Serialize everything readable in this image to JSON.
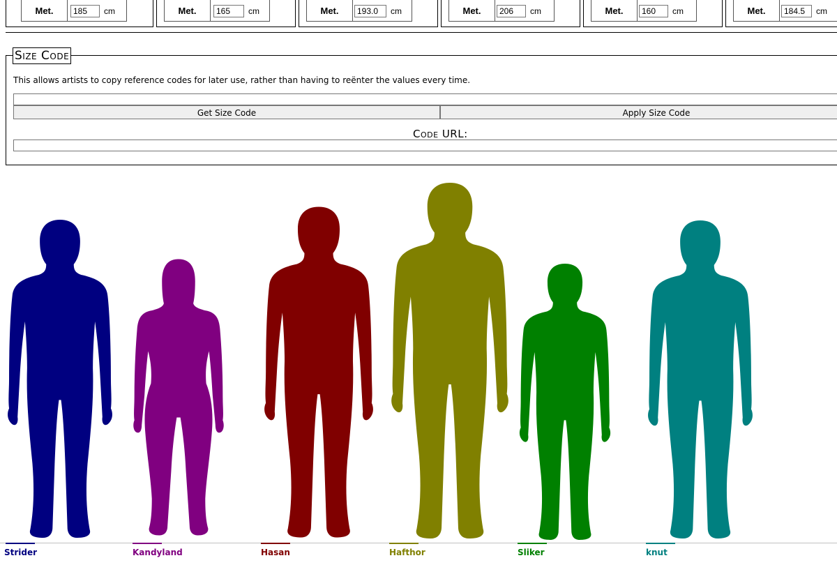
{
  "top_panels": {
    "met_label": "Met.",
    "unit": "cm",
    "values": [
      "185",
      "165",
      "193.0",
      "206",
      "160",
      "184.5"
    ]
  },
  "size_code": {
    "title": "Size Code",
    "description": "This allows artists to copy reference codes for later use, rather than having to reënter the values every time.",
    "code_value": "",
    "get_button": "Get Size Code",
    "apply_button": "Apply Size Code",
    "url_label": "Code URL:",
    "url_value": ""
  },
  "characters": [
    {
      "name": "Strider",
      "height_cm": 185,
      "color": "#000080",
      "gender": "male"
    },
    {
      "name": "Kandyland",
      "height_cm": 165,
      "color": "#800080",
      "gender": "female"
    },
    {
      "name": "Hasan",
      "height_cm": 193.0,
      "color": "#800000",
      "gender": "male"
    },
    {
      "name": "Hafthor",
      "height_cm": 206,
      "color": "#808000",
      "gender": "male"
    },
    {
      "name": "Sliker",
      "height_cm": 160,
      "color": "#008000",
      "gender": "male"
    },
    {
      "name": "knut",
      "height_cm": 184.5,
      "color": "#008080",
      "gender": "male"
    }
  ]
}
